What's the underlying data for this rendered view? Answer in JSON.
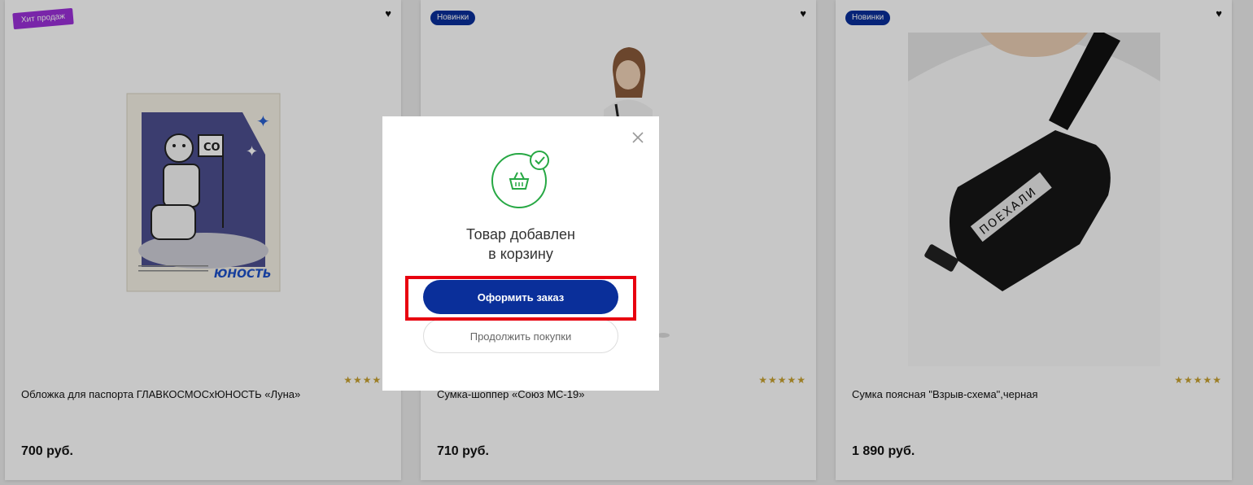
{
  "products": [
    {
      "badge": "Хит продаж",
      "badge_color": "#9b30d9",
      "title": "Обложка для паспорта ГЛАВКОСМОСхЮНОСТЬ «Луна»",
      "price": "700 руб.",
      "rating": "★★★★★",
      "image": "passport-cover-moon-dog",
      "image_logo": "ЮНОСТЬ",
      "image_flag": "СО"
    },
    {
      "badge": "Новинки",
      "badge_color": "#0a2f9a",
      "title": "Сумка-шоппер «Союз МС-19»",
      "price": "710 руб.",
      "rating": "★★★★★",
      "image": "woman-with-shopper-bag"
    },
    {
      "badge": "Новинки",
      "badge_color": "#0a2f9a",
      "title": "Сумка поясная \"Взрыв-схема\",черная",
      "price": "1 890 руб.",
      "rating": "★★★★★",
      "image": "black-waist-bag",
      "image_text": "ПОЕХАЛИ"
    }
  ],
  "modal": {
    "icon": "basket-check-icon",
    "title": "Товар добавлен\nв корзину",
    "primary_button": "Оформить заказ",
    "secondary_button": "Продолжить покупки",
    "accent_color": "#0a2f9a",
    "success_color": "#27a844",
    "highlight_color": "#e8000f"
  }
}
